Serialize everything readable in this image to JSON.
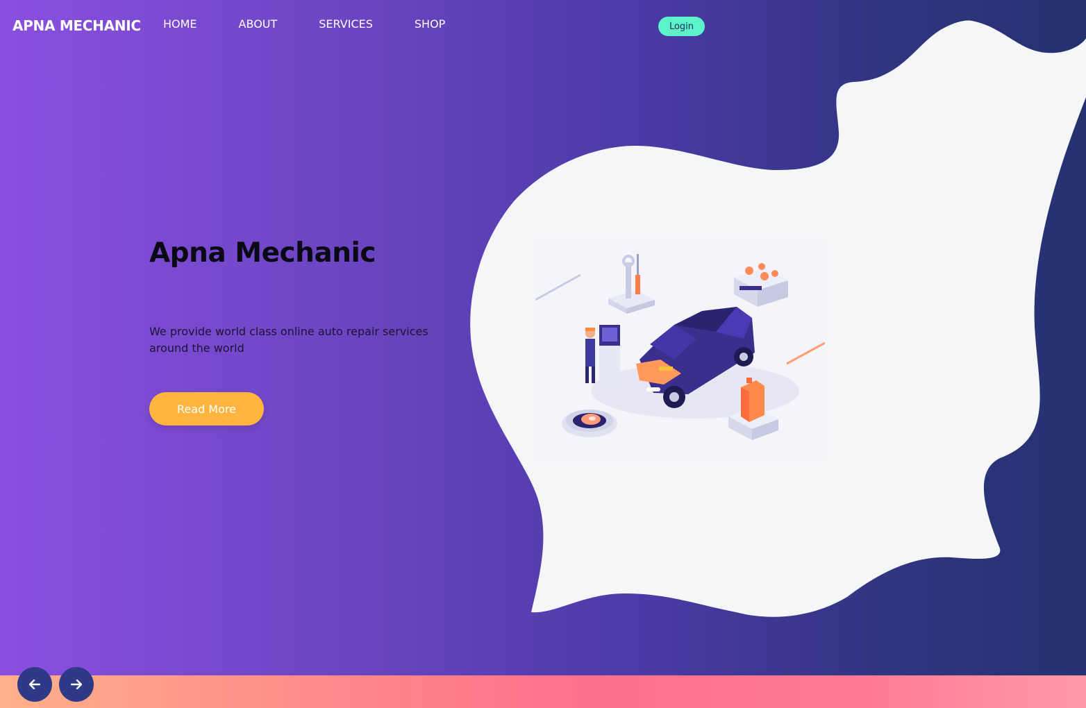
{
  "brand": "APNA MECHANIC",
  "nav": {
    "items": [
      {
        "label": "HOME"
      },
      {
        "label": "ABOUT"
      },
      {
        "label": "SERVICES"
      },
      {
        "label": "SHOP"
      }
    ]
  },
  "login_label": "Login",
  "hero": {
    "title": "Apna Mechanic",
    "description": "We provide world class online auto repair services around the world",
    "cta_label": "Read More"
  },
  "slider": {
    "prev_icon": "arrow-left-icon",
    "next_icon": "arrow-right-icon"
  },
  "colors": {
    "accent_login": "#5ef2cb",
    "accent_cta": "#ffb43f",
    "nav_button": "#2e3a86"
  }
}
